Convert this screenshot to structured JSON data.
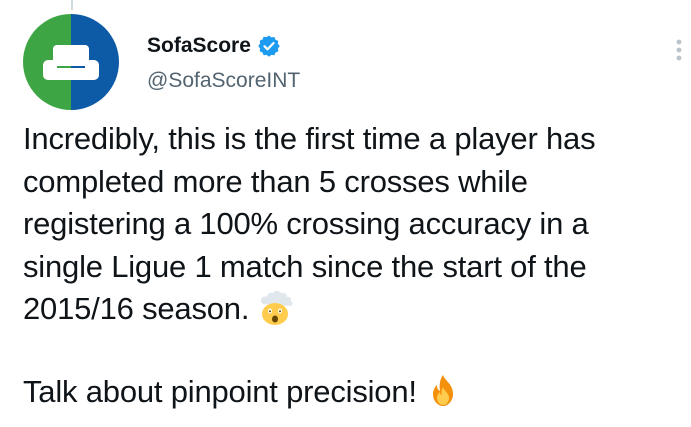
{
  "author": {
    "display_name": "SofaScore",
    "handle": "@SofaScoreINT",
    "verified": true,
    "avatar_colors": [
      "#3ea544",
      "#0d5aa7"
    ]
  },
  "tweet": {
    "paragraph_1": "Incredibly, this is the first time a player has completed more than 5 crosses while registering a 100% crossing accuracy in a single Ligue 1 match since the start of the 2015/16 season.",
    "paragraph_1_emoji": "exploding-head-emoji",
    "paragraph_2": "Talk about pinpoint precision!",
    "paragraph_2_emoji": "fire-emoji"
  },
  "colors": {
    "text": "#0f1419",
    "secondary_text": "#536471",
    "verified": "#1d9bf0"
  }
}
